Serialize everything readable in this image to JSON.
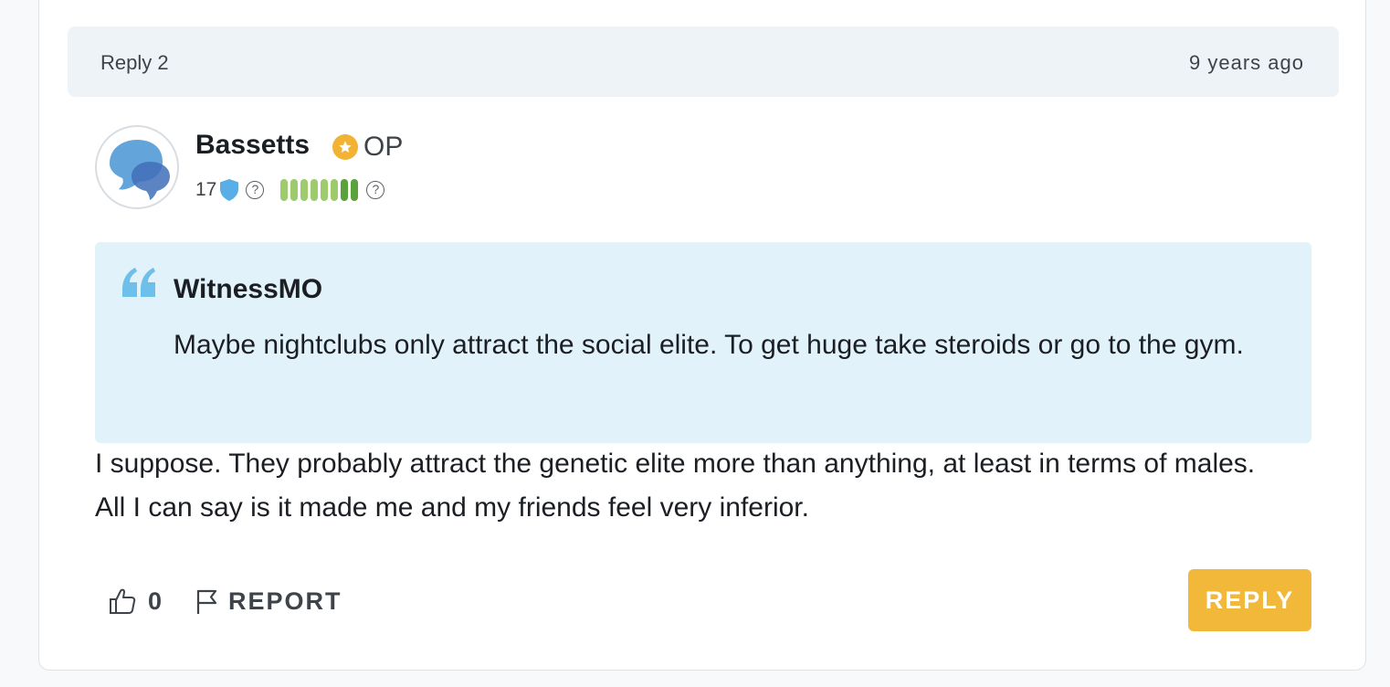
{
  "reply": {
    "number_label": "Reply 2",
    "timestamp": "9 years ago"
  },
  "author": {
    "avatar_icon": "speech-bubbles-icon",
    "username": "Bassetts",
    "op_label": "OP",
    "points": "17",
    "points_icon": "shield-icon",
    "help_icon": "question-circle-icon",
    "level": {
      "filled": 8,
      "total": 8,
      "dark_last": 2
    }
  },
  "quote": {
    "author": "WitnessMO",
    "text": "Maybe nightclubs only attract the social elite. To get huge take steroids or go to the gym."
  },
  "body": "I suppose. They probably attract the genetic elite more than anything, at least in terms of males. All I can say is it made me and my friends feel very inferior.",
  "actions": {
    "like_count": "0",
    "report_label": "REPORT",
    "reply_label": "REPLY"
  },
  "colors": {
    "accent": "#f2b83a",
    "quote_bg": "#e2f2fb",
    "header_bg": "#edf3f6",
    "level_light": "#9dcb6e",
    "level_dark": "#5aa33c",
    "shield": "#5aaee8"
  }
}
